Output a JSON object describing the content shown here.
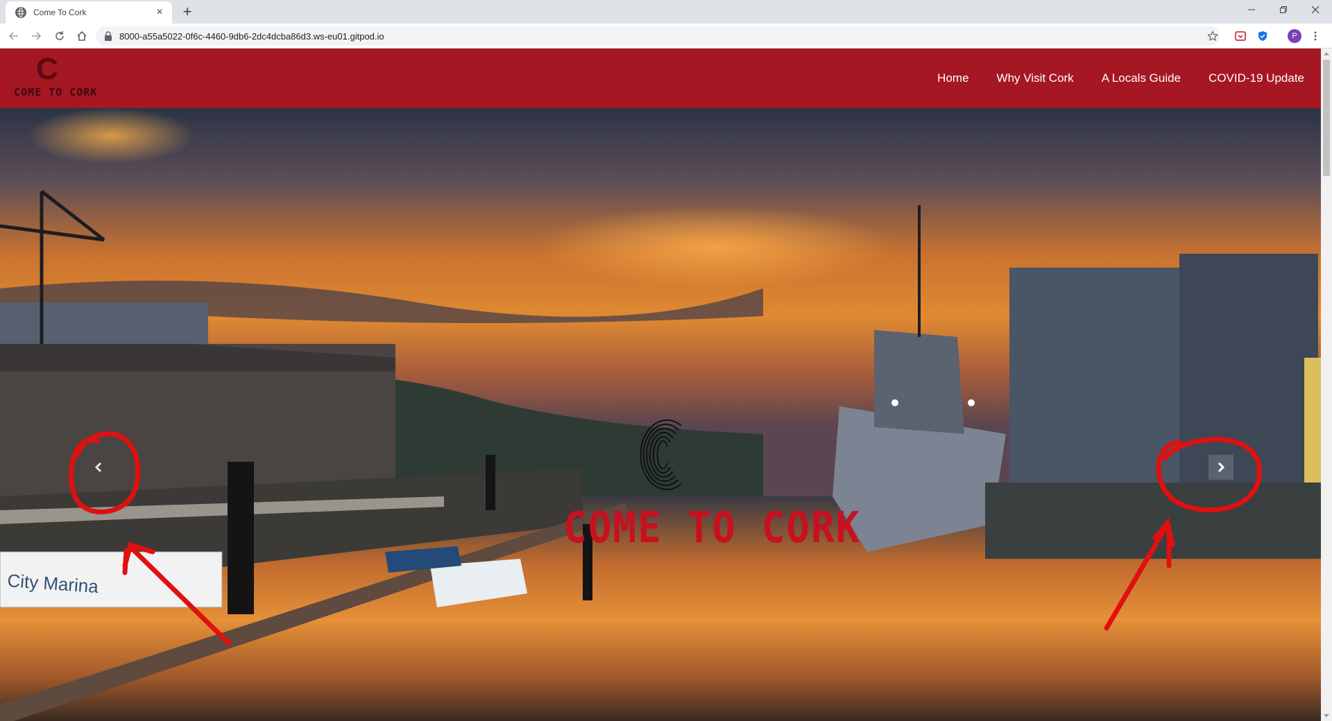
{
  "browser": {
    "tab_title": "Come To Cork",
    "tab_close": "×",
    "new_tab": "+",
    "url": "8000-a55a5022-0f6c-4460-9db6-2dc4dcba86d3.ws-eu01.gitpod.io",
    "profile_initial": "P"
  },
  "site": {
    "brand_letter": "C",
    "brand_text": "COME TO CORK",
    "nav": [
      "Home",
      "Why Visit Cork",
      "A Locals Guide",
      "COVID-19 Update"
    ]
  },
  "hero": {
    "title": "COME TO CORK",
    "marina_sign": "City Marina"
  },
  "colors": {
    "header_bg": "#a51723",
    "hero_title": "#c8101e",
    "annotation": "#e01010"
  }
}
